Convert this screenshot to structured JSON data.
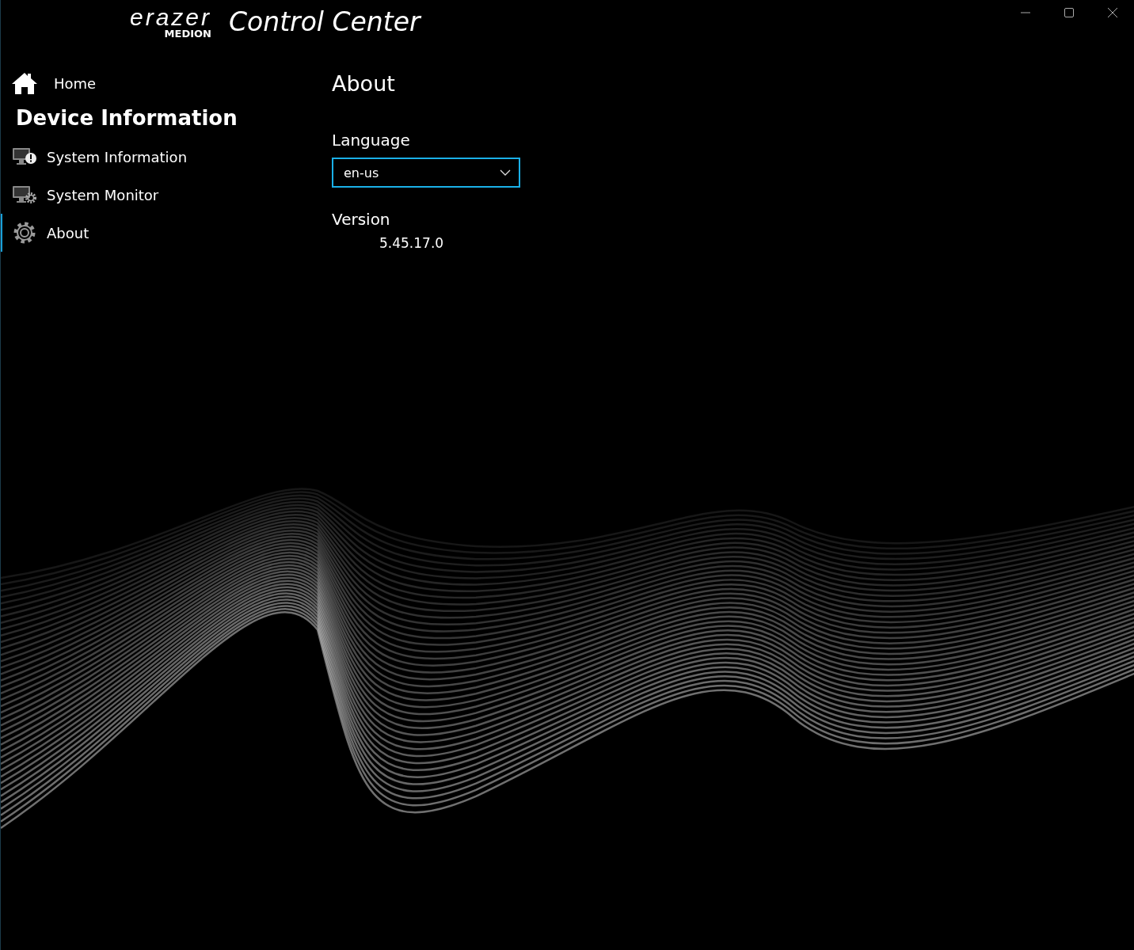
{
  "window": {
    "logo": {
      "brand": "erazer",
      "maker": "MEDION"
    },
    "title": "Control Center"
  },
  "sidebar": {
    "home": {
      "label": "Home"
    },
    "section": "Device Information",
    "items": [
      {
        "label": "System Information",
        "kind": "info",
        "selected": false
      },
      {
        "label": "System Monitor",
        "kind": "monitor",
        "selected": false
      },
      {
        "label": "About",
        "kind": "gear",
        "selected": true
      }
    ]
  },
  "content": {
    "heading": "About",
    "language": {
      "label": "Language",
      "value": "en-us"
    },
    "version": {
      "label": "Version",
      "value": "5.45.17.0"
    }
  }
}
